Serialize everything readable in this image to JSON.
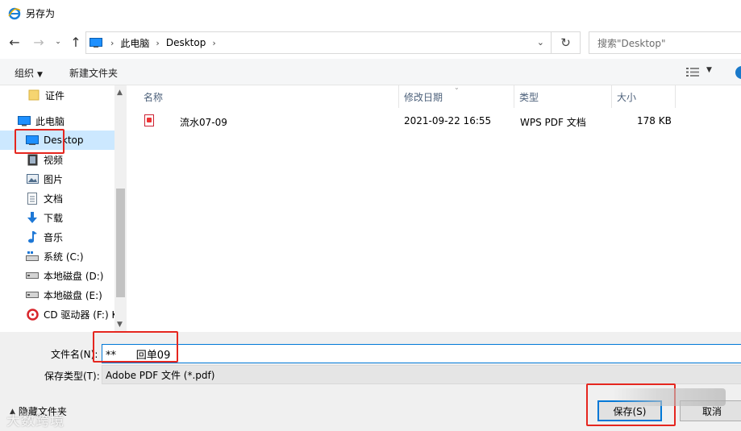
{
  "window": {
    "title": "另存为"
  },
  "address": {
    "breadcrumbs": [
      "此电脑",
      "Desktop"
    ],
    "search_placeholder": "搜索\"Desktop\""
  },
  "toolbar": {
    "organize_label": "组织",
    "new_folder_label": "新建文件夹"
  },
  "nav": {
    "items": [
      {
        "label": "证件",
        "icon": "folder-icon"
      },
      {
        "label": "此电脑",
        "icon": "pc-icon"
      },
      {
        "label": "Desktop",
        "icon": "desktop-icon",
        "selected": true
      },
      {
        "label": "视频",
        "icon": "video-icon"
      },
      {
        "label": "图片",
        "icon": "picture-icon"
      },
      {
        "label": "文档",
        "icon": "document-icon"
      },
      {
        "label": "下载",
        "icon": "download-icon"
      },
      {
        "label": "音乐",
        "icon": "music-icon"
      },
      {
        "label": "系统 (C:)",
        "icon": "system-drive-icon"
      },
      {
        "label": "本地磁盘 (D:)",
        "icon": "drive-icon"
      },
      {
        "label": "本地磁盘 (E:)",
        "icon": "drive-icon"
      },
      {
        "label": "CD 驱动器 (F:) K",
        "icon": "cd-drive-icon"
      }
    ]
  },
  "table": {
    "columns": [
      "名称",
      "修改日期",
      "类型",
      "大小"
    ],
    "rows": [
      {
        "name": "流水07-09",
        "date": "2021-09-22 16:55",
        "type": "WPS PDF 文档",
        "size": "178 KB",
        "icon": "pdf-icon"
      }
    ]
  },
  "bottom": {
    "filename_label": "文件名(N):",
    "filename_value": "**      回单09",
    "filetype_label": "保存类型(T):",
    "filetype_value": "Adobe PDF 文件 (*.pdf)",
    "hide_folders_label": "隐藏文件夹",
    "save_label": "保存(S)",
    "cancel_label": "取消"
  },
  "watermark": "大数跨境",
  "colors": {
    "highlight": "#e5261f",
    "accent": "#0078d7",
    "selection": "#cce8ff"
  }
}
